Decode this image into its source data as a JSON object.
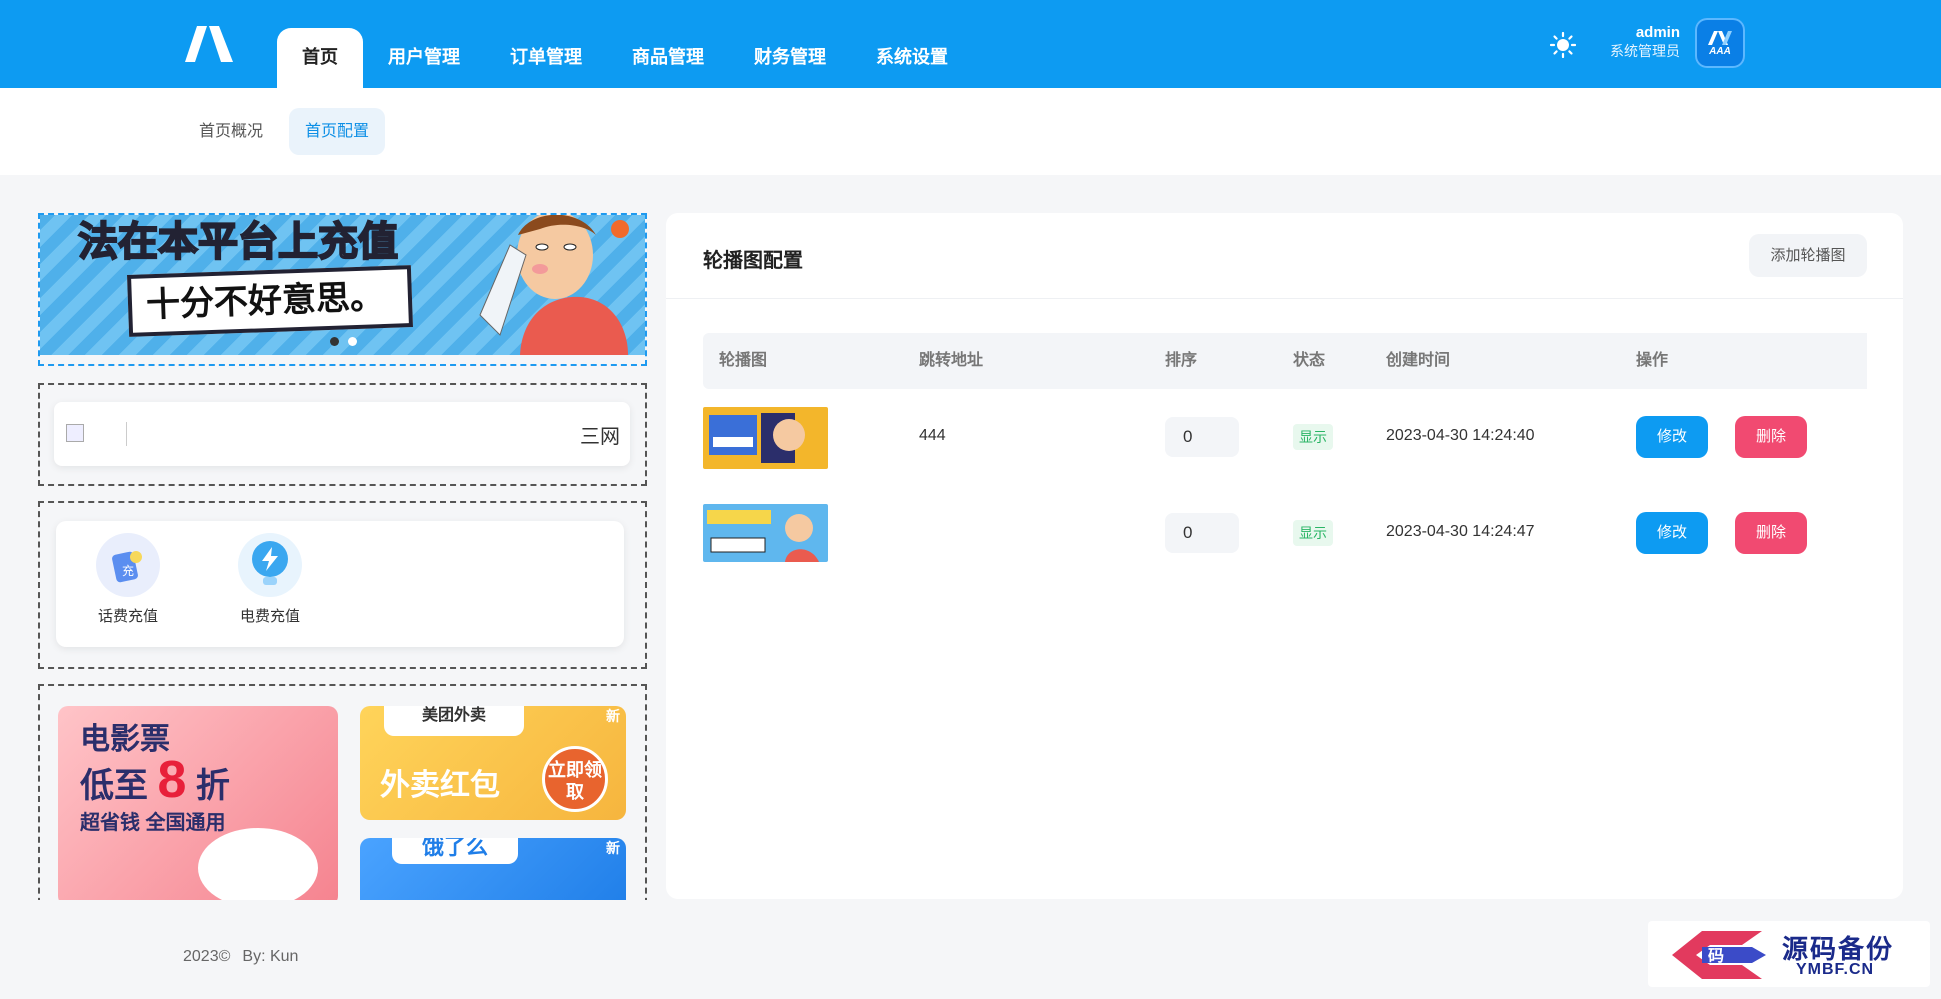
{
  "header": {
    "nav": [
      {
        "label": "首页",
        "active": true
      },
      {
        "label": "用户管理"
      },
      {
        "label": "订单管理"
      },
      {
        "label": "商品管理"
      },
      {
        "label": "财务管理"
      },
      {
        "label": "系统设置"
      }
    ],
    "theme_icon": "sun-icon",
    "user": {
      "name": "admin",
      "role": "系统管理员",
      "avatar_text": "AAA"
    },
    "brand_color": "#0d9bf2"
  },
  "subnav": {
    "items": [
      {
        "label": "首页概况"
      },
      {
        "label": "首页配置",
        "active": true
      }
    ]
  },
  "preview": {
    "banner": {
      "line1": "法在本平台上充值",
      "line2": "十分不好意思。",
      "dots": 2,
      "active_dot": 0
    },
    "notice": {
      "text": "三网"
    },
    "services": [
      {
        "label": "话费充值",
        "icon": "phone-card-icon",
        "badge": "充"
      },
      {
        "label": "电费充值",
        "icon": "lightning-bulb-icon"
      }
    ],
    "ads": {
      "movie": {
        "line1": "电影票",
        "line2a": "低至",
        "line2b": "8",
        "line2c": "折",
        "line3": "超省钱 全国通用"
      },
      "meituan": {
        "brand": "美团外卖",
        "text": "外卖红包",
        "button": "立即领取",
        "badge": "新"
      },
      "eleme": {
        "brand": "饿了么",
        "badge": "新"
      }
    }
  },
  "panel": {
    "title": "轮播图配置",
    "add_button": "添加轮播图",
    "columns": [
      "轮播图",
      "跳转地址",
      "排序",
      "状态",
      "创建时间",
      "操作"
    ],
    "rows": [
      {
        "link": "444",
        "sort": "0",
        "status": "显示",
        "created": "2023-04-30 14:24:40",
        "edit": "修改",
        "delete": "删除"
      },
      {
        "link": "",
        "sort": "0",
        "status": "显示",
        "created": "2023-04-30 14:24:47",
        "edit": "修改",
        "delete": "删除"
      }
    ]
  },
  "footer": {
    "year": "2023©",
    "by": "By: Kun"
  },
  "watermark": {
    "name": "源码备份",
    "url": "YMBF.CN",
    "badge": "码"
  }
}
